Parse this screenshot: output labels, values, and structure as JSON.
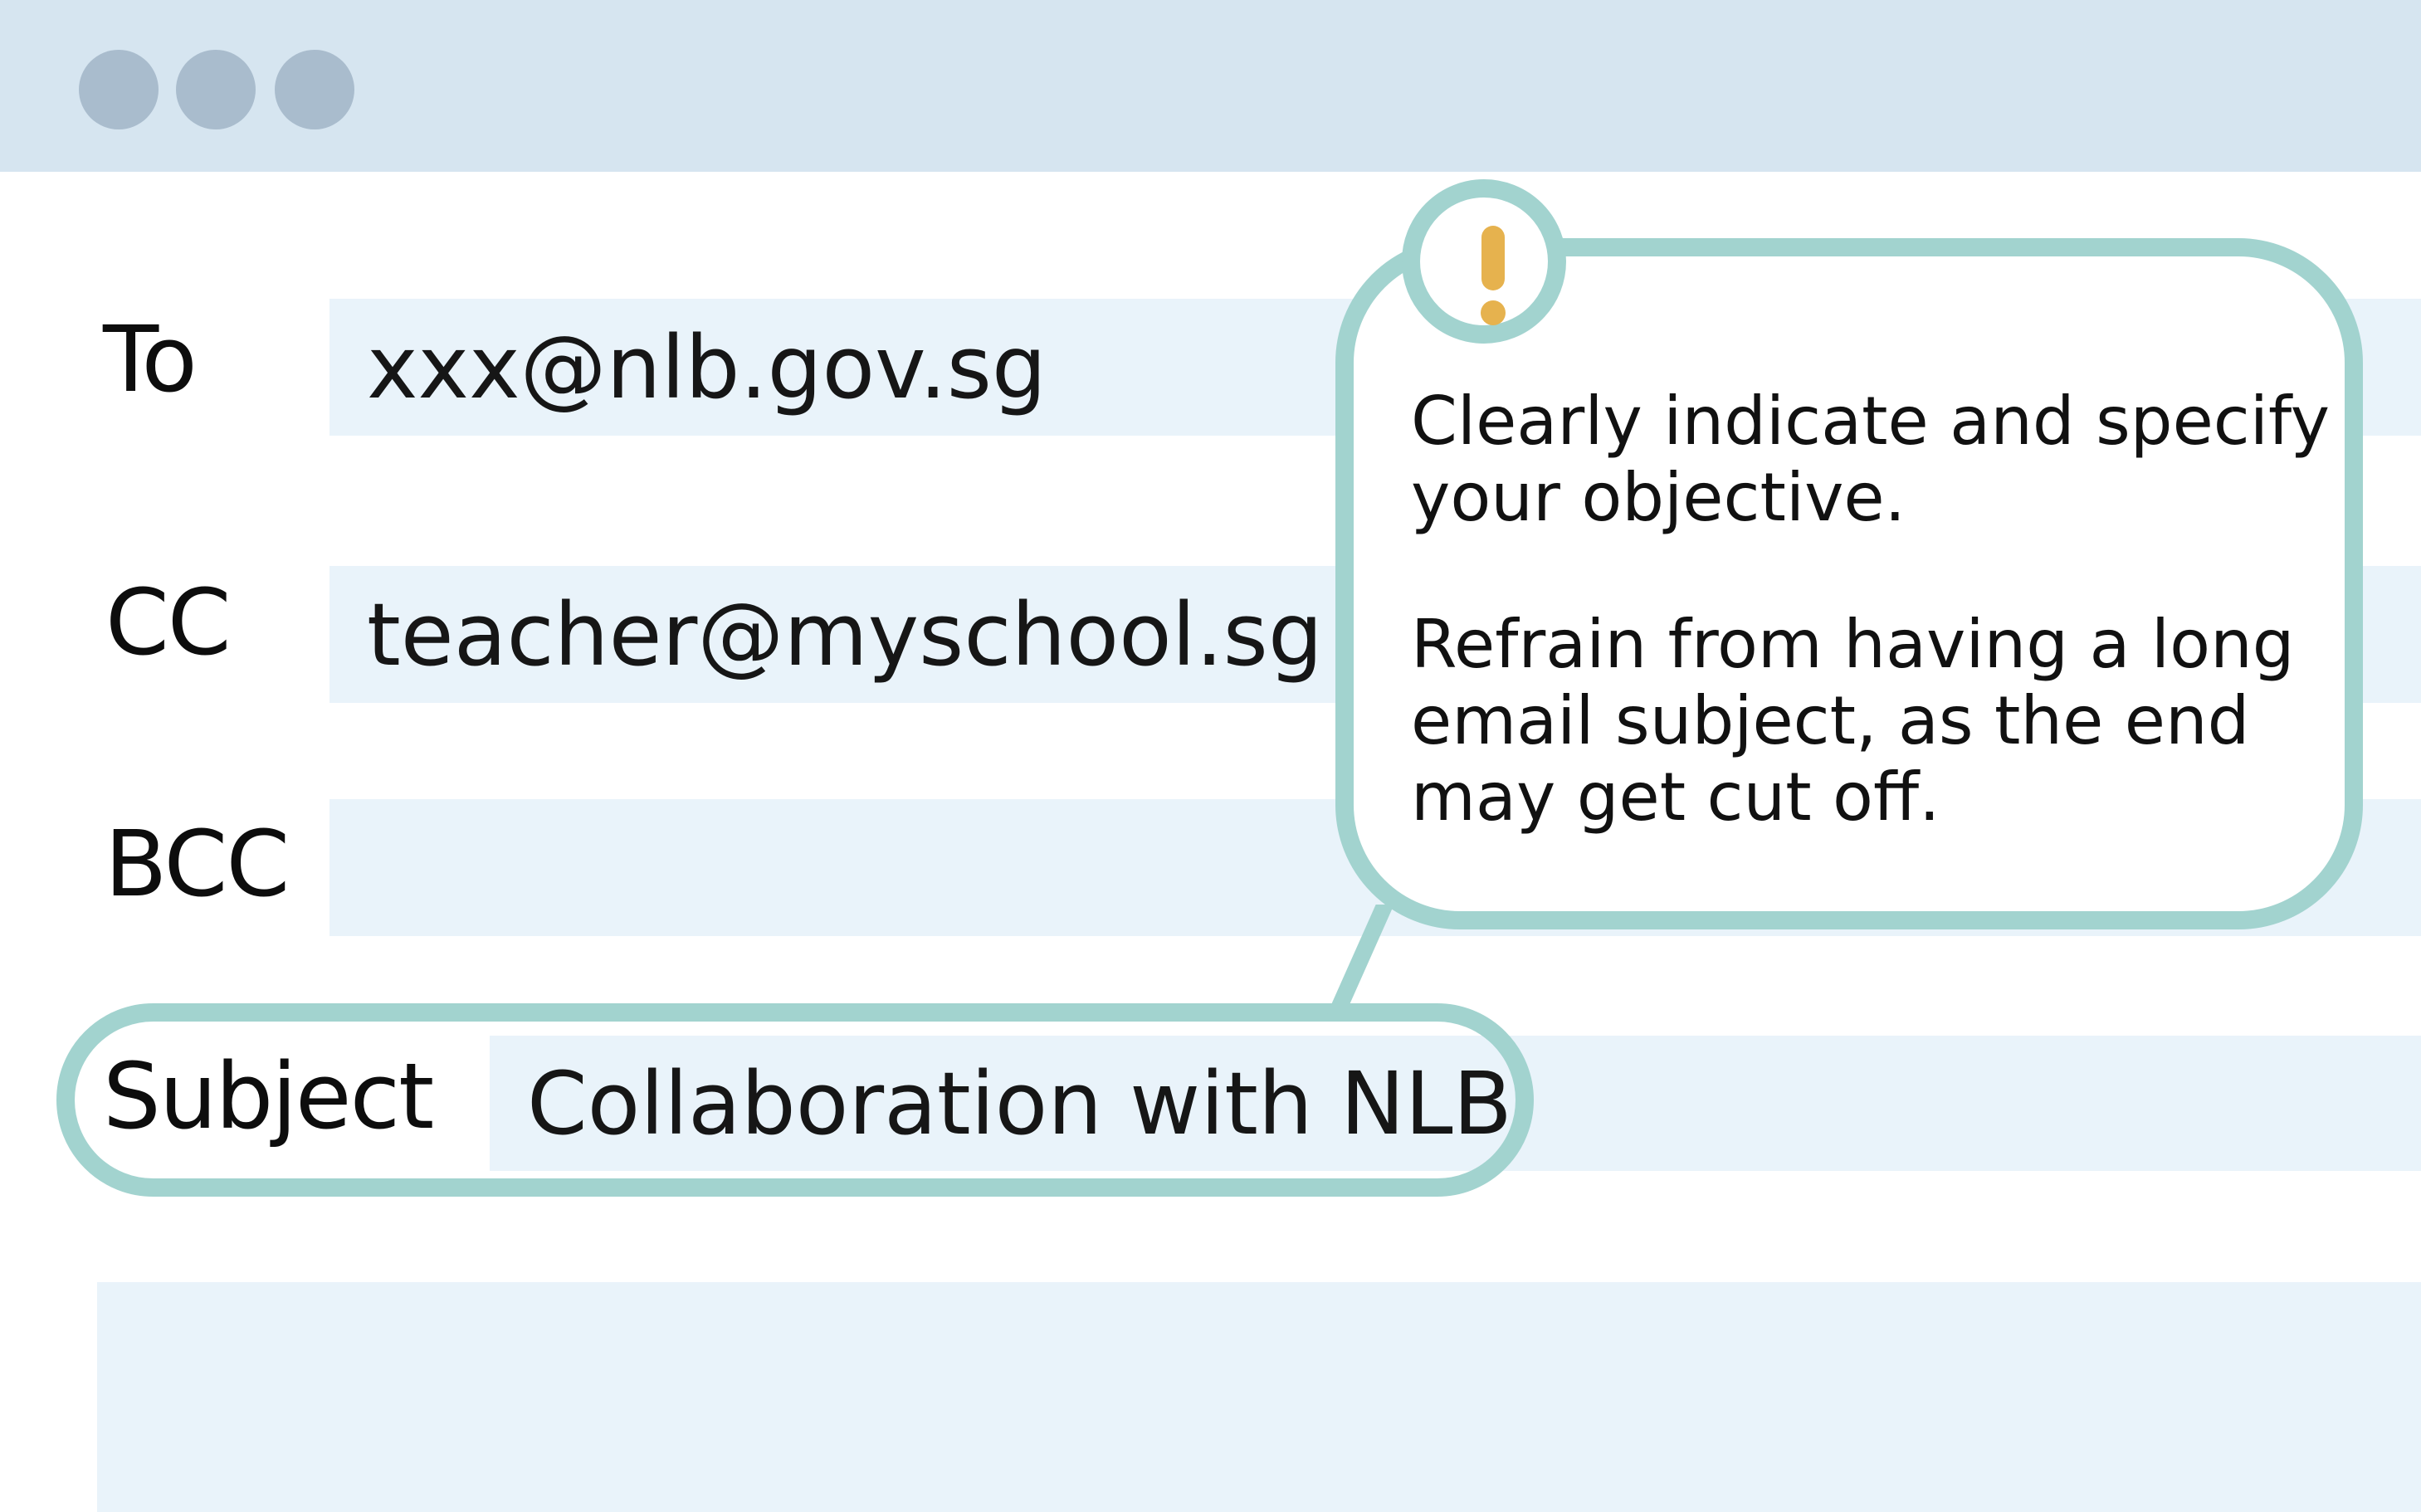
{
  "window": {
    "controls": [
      "window-dot",
      "window-dot",
      "window-dot"
    ]
  },
  "fields": {
    "to_label": "To",
    "to_value": "xxx@nlb.gov.sg",
    "cc_label": "CC",
    "cc_value": "teacher@myschool.sg",
    "bcc_label": "BCC",
    "bcc_value": "",
    "subject_label": "Subject",
    "subject_value": "Collaboration with NLB"
  },
  "callout": {
    "icon": "exclamation-icon",
    "tip_1": "Clearly indicate and specify your objective.",
    "tip_2": "Refrain from having a long email subject, as the end may get cut off."
  },
  "colors": {
    "titlebar": "#d6e5f0",
    "window_dots": "#a9bccd",
    "field_background": "#e9f3fa",
    "highlight_outline": "#a2d3cf",
    "warning_accent": "#e6b24e"
  }
}
